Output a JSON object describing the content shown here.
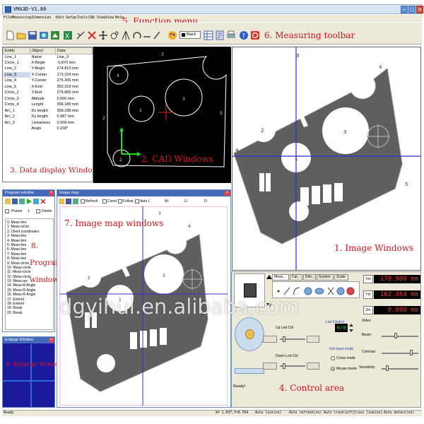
{
  "window": {
    "title": "VMA3D-V1.80"
  },
  "menu": {
    "items": [
      "File",
      "Measuring",
      "Dimension",
      "Edit",
      "Setup",
      "Tools",
      "CAD View",
      "View",
      "Help"
    ]
  },
  "toolbar": {
    "color_select": "Black"
  },
  "annotations": {
    "function_menu": "5. Function menu",
    "measuring_toolbar": "6. Measuring toolbar",
    "data_display": "3. Data display Windows",
    "cad_windows": "2. CAD Windows",
    "image_windows": "1. Image Windows",
    "image_map": "7. Image map windows",
    "program_num": "8.",
    "program_word": "Program",
    "program_windows": "windows",
    "enlarge": "9. Enlarge Windows",
    "control_area": "4. Control area"
  },
  "data_panel": {
    "headers": [
      "Entity",
      "Object",
      "Data"
    ],
    "entities": [
      "Line_1",
      "Circle_1",
      "Line_2",
      "Line_3",
      "Line_4",
      "Line_5",
      "Circle_2",
      "Circle_3",
      "Circle_4",
      "Arc_1",
      "Arc_2",
      "Arc_3"
    ],
    "rows": [
      {
        "name": "Name",
        "value": "Line_3"
      },
      {
        "name": "X-Begin",
        "value": "-5.870 mm"
      },
      {
        "name": "Y-Begin",
        "value": "274.813 mm"
      },
      {
        "name": "X-Center",
        "value": "173.224 mm"
      },
      {
        "name": "Y-Center",
        "value": "275.306 mm"
      },
      {
        "name": "X-End",
        "value": "352.318 mm"
      },
      {
        "name": "Y-End",
        "value": "275.800 mm"
      },
      {
        "name": "Altitude",
        "value": "0.000 mm"
      },
      {
        "name": "Lenght",
        "value": "358.189 mm"
      },
      {
        "name": "Dx lenght",
        "value": "358.188 mm"
      },
      {
        "name": "Dy lenght",
        "value": "0.987 mm"
      },
      {
        "name": "Lineamess",
        "value": "0.008 mm"
      },
      {
        "name": "Angle",
        "value": "0.158°"
      }
    ]
  },
  "cad": {
    "labels": [
      "3",
      "4",
      "1",
      "2",
      "3",
      "5",
      "2"
    ]
  },
  "image_window": {
    "labels": [
      "3",
      "4",
      "2",
      "1",
      "3",
      "4",
      "5"
    ]
  },
  "program_window": {
    "title": "Program window",
    "picture_label": "Picture",
    "picture_number": "1",
    "delete_label": "Delete",
    "items": [
      "0: Meas-line",
      "1: Meas-circle",
      "2: Client coordinates",
      "3: Meas-line",
      "4: Meas-line",
      "5: Meas-line",
      "6: Meas-line",
      "7: Meas-line",
      "8: Meas-line",
      "9: Meas-circle",
      "10: Meas-circle",
      "11: Meas-circle",
      "12: Meas-circle",
      "13: Meas-arc",
      "14: Meas-R-Angle",
      "15: Meas-R-Angle",
      "16: Meas-R-Angle",
      "17: Extend",
      "18: Extend",
      "19: Break",
      "20: Break"
    ]
  },
  "enlarge_window": {
    "title": "Enlarge Window"
  },
  "image_map": {
    "title": "Image map",
    "checkboxes": [
      "Refresh",
      "Const",
      "Follow",
      "Auto L"
    ],
    "coord_labels": [
      "W:",
      "U:",
      "D:"
    ],
    "labels": [
      "3",
      "4",
      "2",
      "1",
      "3"
    ]
  },
  "control": {
    "tabs": [
      "Meas...",
      "Cal...",
      "Dim...",
      "System",
      "Scale"
    ],
    "coords": [
      {
        "axis": "Xm",
        "value": "178.900 mm"
      },
      {
        "axis": "Ym",
        "value": "102.464 mm"
      },
      {
        "axis": "Zm",
        "value": "0.000 mm"
      }
    ],
    "up_led": "Up Led Ctrl",
    "down_led": "Down Led Ctrl",
    "led_control": "Led Control",
    "led_value": "0/0",
    "video": "Video",
    "beam": "Beam",
    "contrast": "Contrast",
    "sensitivity": "Sensitivity",
    "input_mode": "Get input mode",
    "cross_mode": "Cross mode",
    "mouse_mode": "Mouse mode",
    "status": "Ready!"
  },
  "statusbar": {
    "ready": "Ready",
    "coords": "X= 1.037,Y=0.764",
    "items": [
      "Auto lock(on)",
      "Auto refresh(on)",
      "Auto track(off)",
      "Cross line(on)",
      "Auto detect(on)"
    ]
  },
  "watermark": "dgyihui.en.alibaba.com",
  "colors": {
    "annotation": "#d4141c",
    "panel_header": "#4569b9",
    "cad_background": "#000000",
    "part_gray": "#5f5f5f",
    "coord_red": "#ff3030"
  }
}
